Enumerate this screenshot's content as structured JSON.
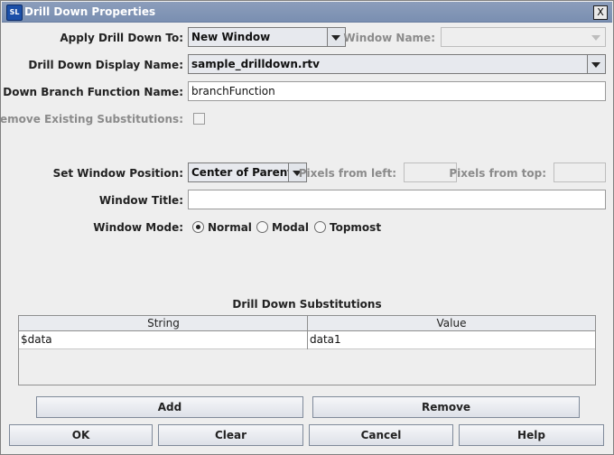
{
  "window": {
    "title": "Drill Down Properties",
    "app_icon_text": "SL",
    "close_glyph": "X"
  },
  "form": {
    "apply_to": {
      "label": "Apply Drill Down To:",
      "value": "New Window"
    },
    "window_name": {
      "label": "Window Name:",
      "value": ""
    },
    "display_name": {
      "label": "Drill Down Display Name:",
      "value": "sample_drilldown.rtv"
    },
    "branch_function": {
      "label": "Drill Down Branch Function Name:",
      "value": "branchFunction"
    },
    "remove_existing": {
      "label": "Remove Existing Substitutions:",
      "checked": false
    },
    "window_position": {
      "label": "Set Window Position:",
      "value": "Center of Parent"
    },
    "pixels_left": {
      "label": "Pixels from left:",
      "value": ""
    },
    "pixels_top": {
      "label": "Pixels from top:",
      "value": ""
    },
    "window_title": {
      "label": "Window Title:",
      "value": ""
    },
    "window_mode": {
      "label": "Window Mode:",
      "selected": "Normal",
      "options": [
        "Normal",
        "Modal",
        "Topmost"
      ]
    }
  },
  "substitutions": {
    "title": "Drill Down Substitutions",
    "columns": [
      "String",
      "Value"
    ],
    "rows": [
      {
        "string": "$data",
        "value": "data1"
      }
    ]
  },
  "buttons": {
    "add": "Add",
    "remove": "Remove",
    "ok": "OK",
    "clear": "Clear",
    "cancel": "Cancel",
    "help": "Help"
  }
}
